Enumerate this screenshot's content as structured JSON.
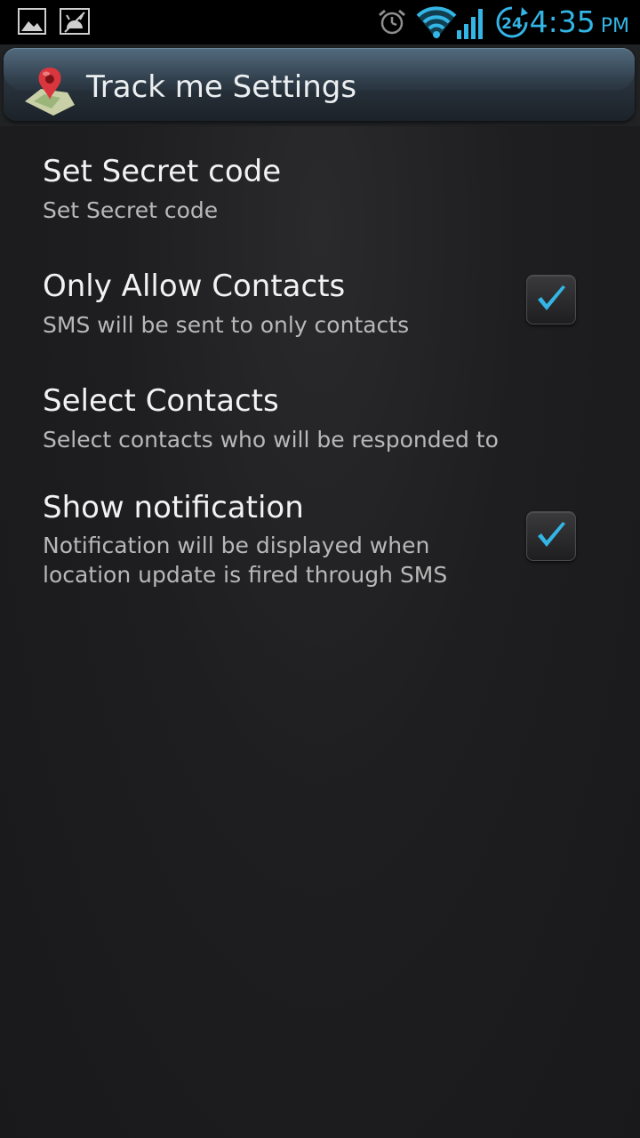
{
  "status_bar": {
    "time": "4:35",
    "ampm": "PM",
    "data_badge": "24",
    "icons": [
      "gallery-icon",
      "android-update-icon",
      "alarm-icon",
      "wifi-icon",
      "signal-icon",
      "data-counter-icon"
    ],
    "accent_color": "#33b5e5"
  },
  "action_bar": {
    "title": "Track me Settings",
    "icon": "map-pin-icon"
  },
  "preferences": [
    {
      "title": "Set Secret code",
      "summary": "Set Secret code"
    },
    {
      "title": "Only Allow Contacts",
      "summary": "SMS will be sent to only contacts",
      "checked": true
    },
    {
      "title": "Select Contacts",
      "summary": "Select contacts who will be responded to"
    },
    {
      "title": "Show notification",
      "summary": "Notification will be displayed when location update is fired through SMS",
      "checked": true
    }
  ]
}
